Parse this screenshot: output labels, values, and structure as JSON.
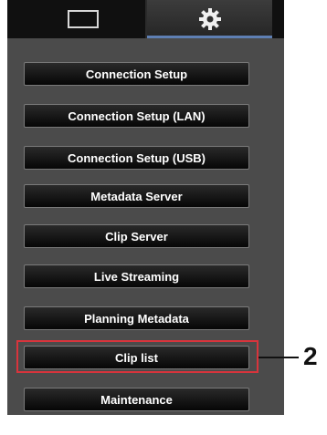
{
  "tabs": {
    "left_icon": "monitor-icon",
    "right_icon": "gear-icon",
    "active": "settings"
  },
  "menu": {
    "items": [
      {
        "label": "Connection Setup"
      },
      {
        "label": "Connection Setup (LAN)"
      },
      {
        "label": "Connection Setup (USB)"
      },
      {
        "label": "Metadata Server"
      },
      {
        "label": "Clip Server"
      },
      {
        "label": "Live Streaming"
      },
      {
        "label": "Planning Metadata"
      },
      {
        "label": "Clip list"
      },
      {
        "label": "Maintenance"
      }
    ]
  },
  "callout": {
    "number": "2"
  },
  "colors": {
    "panel_bg": "#4b4b4b",
    "tabbar_bg": "#101010",
    "active_tab_underline": "#5e7fb3",
    "highlight_border": "#d8343c",
    "button_text": "#ffffff"
  }
}
